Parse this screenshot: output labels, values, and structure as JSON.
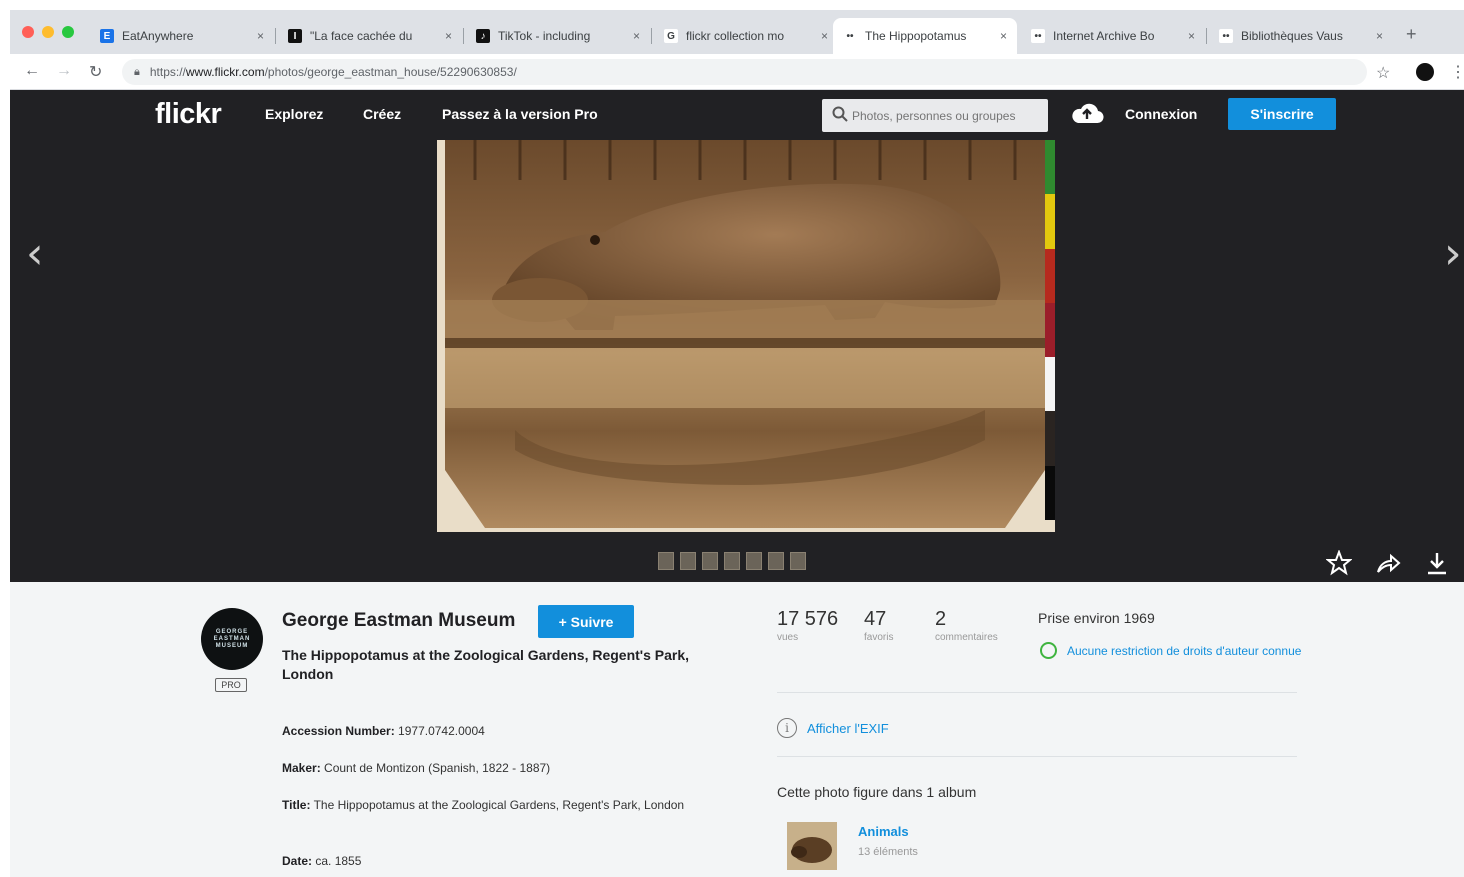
{
  "browser": {
    "tabs": [
      {
        "title": "EatAnywhere",
        "icon": "eatanywhere-favicon",
        "color": "#1a73e8",
        "letter": "E"
      },
      {
        "title": "\"La face cachée du",
        "icon": "article-favicon",
        "color": "#111111",
        "letter": "I"
      },
      {
        "title": "TikTok - including",
        "icon": "tiktok-favicon",
        "color": "#111111",
        "letter": "♪"
      },
      {
        "title": "flickr collection mo",
        "icon": "google-favicon",
        "color": "#ffffff",
        "letter": "G"
      },
      {
        "title": "The Hippopotamus",
        "icon": "flickr-favicon",
        "color": "#ffffff",
        "letter": "••",
        "active": true
      },
      {
        "title": "Internet Archive Bo",
        "icon": "flickr-favicon",
        "color": "#ffffff",
        "letter": "••"
      },
      {
        "title": "Bibliothèques Vaus",
        "icon": "flickr-favicon",
        "color": "#ffffff",
        "letter": "••"
      }
    ],
    "close_glyph": "×",
    "new_tab_glyph": "+",
    "url_prefix": "https://",
    "url_host": "www.flickr.com",
    "url_path": "/photos/george_eastman_house/52290630853/"
  },
  "flickr": {
    "logo": "flickr",
    "nav": [
      "Explorez",
      "Créez",
      "Passez à la version Pro"
    ],
    "search_placeholder": "Photos, personnes ou groupes",
    "login": "Connexion",
    "signup": "S'inscrire"
  },
  "photo": {
    "prev_glyph": "‹",
    "next_glyph": "›",
    "actions": [
      "star-outline-icon",
      "share-icon",
      "download-icon"
    ],
    "strip_colors": [
      "#2f8a2f",
      "#e3c80e",
      "#b62a1e",
      "#9b1e2a",
      "#f5f5f5",
      "#2a2421",
      "#0a0a0a"
    ]
  },
  "owner": {
    "name": "George Eastman Museum",
    "avatar_text": [
      "GEORGE",
      "EASTMAN",
      "MUSEUM"
    ],
    "pro_badge": "PRO",
    "follow": "+ Suivre"
  },
  "details": {
    "title": "The Hippopotamus at the Zoological Gardens, Regent's Park, London",
    "accession_label": "Accession Number:",
    "accession_value": "1977.0742.0004",
    "maker_label": "Maker:",
    "maker_value": "Count de Montizon (Spanish, 1822 - 1887)",
    "title_label": "Title:",
    "title_value": "The Hippopotamus at the Zoological Gardens, Regent's Park, London",
    "date_label": "Date:",
    "date_value": "ca. 1855"
  },
  "stats": {
    "views": "17 576",
    "views_label": "vues",
    "faves": "47",
    "faves_label": "favoris",
    "comments": "2",
    "comments_label": "commentaires"
  },
  "side": {
    "taken": "Prise environ 1969",
    "license": "Aucune restriction de droits d'auteur connue",
    "exif": "Afficher l'EXIF",
    "album_heading": "Cette photo figure dans 1 album",
    "album_name": "Animals",
    "album_count": "13 éléments"
  }
}
